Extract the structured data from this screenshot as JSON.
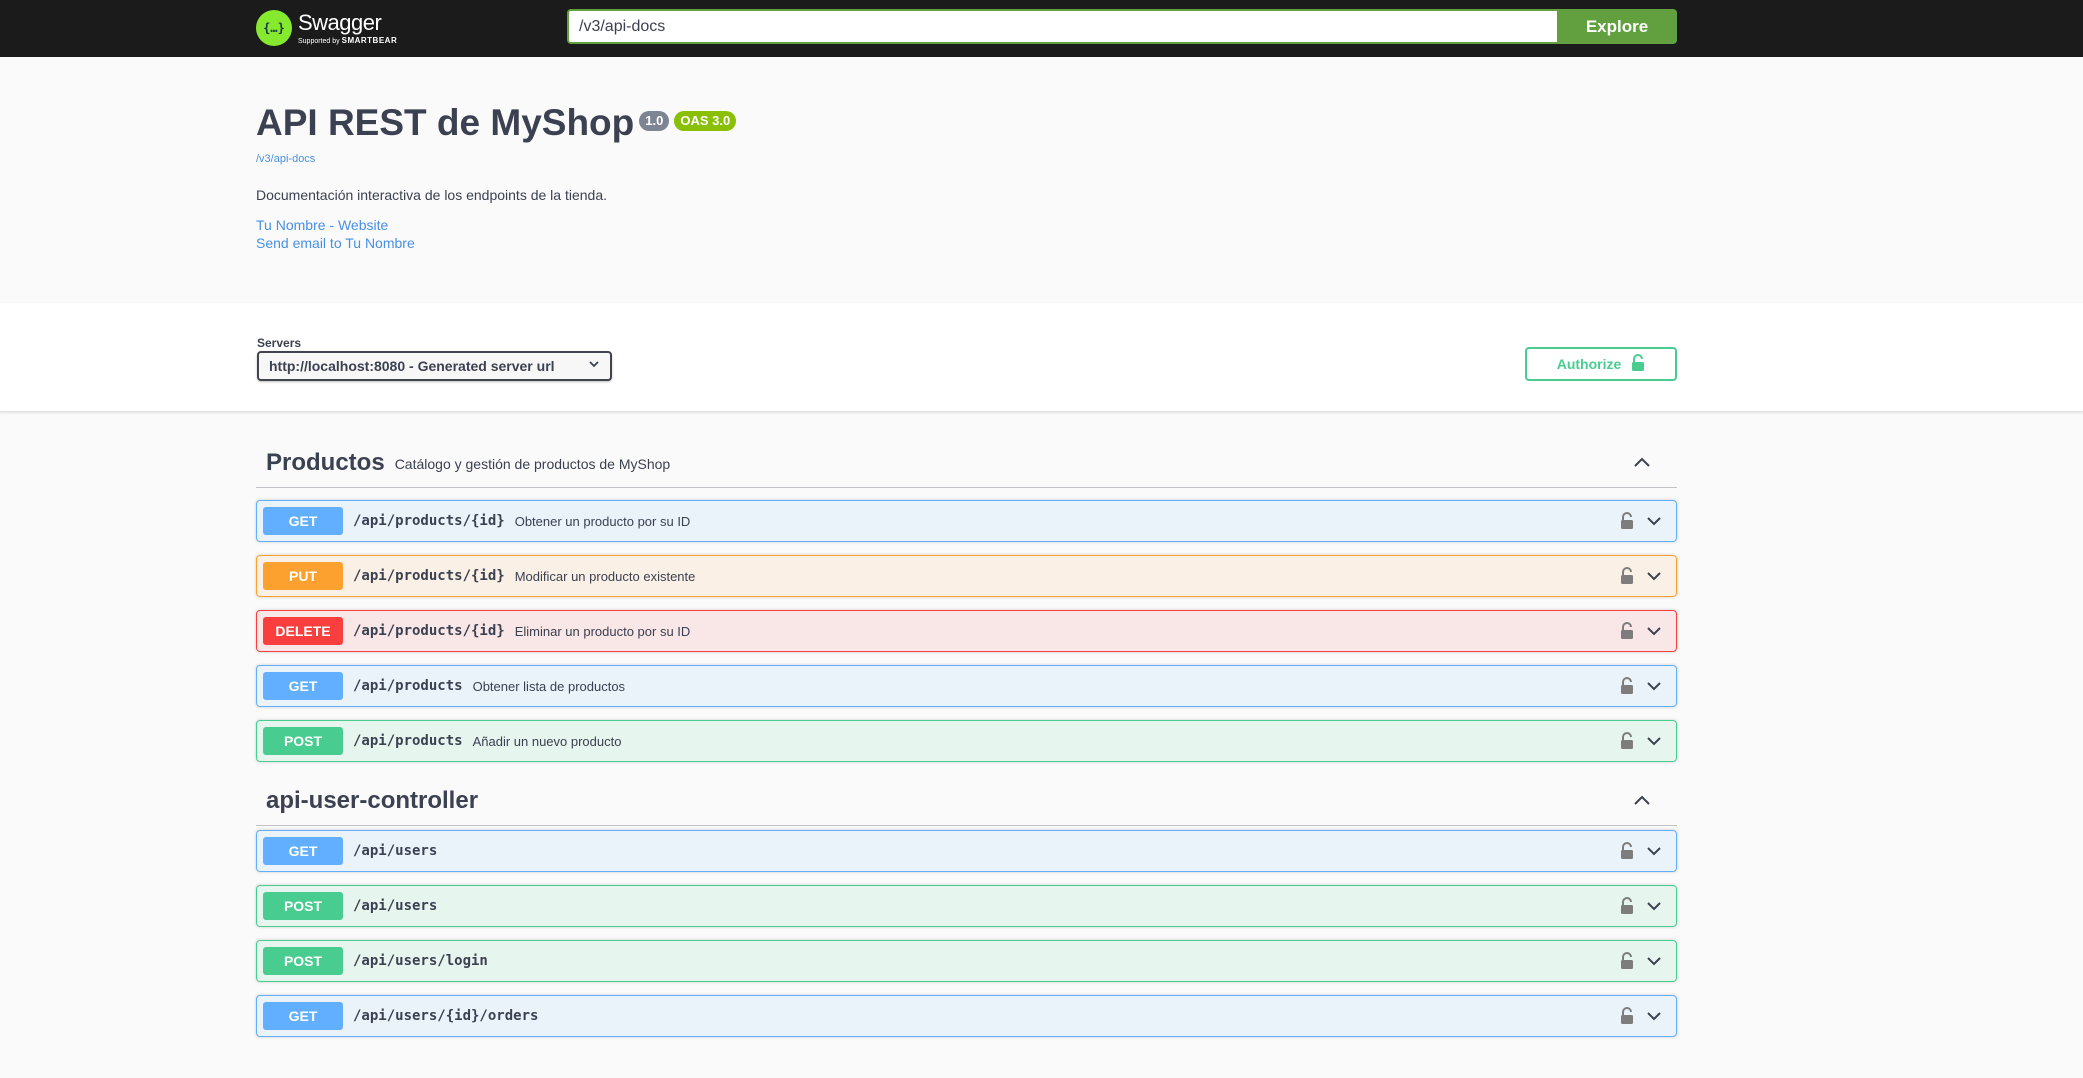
{
  "topbar": {
    "logo_word": "Swagger",
    "logo_sub_prefix": "Supported by",
    "logo_sub_brand": "SMARTBEAR",
    "explore_value": "/v3/api-docs",
    "explore_button": "Explore"
  },
  "info": {
    "title": "API REST de MyShop",
    "version": "1.0",
    "oas": "OAS 3.0",
    "spec_url": "/v3/api-docs",
    "description": "Documentación interactiva de los endpoints de la tienda.",
    "website_link": "Tu Nombre - Website",
    "email_link": "Send email to Tu Nombre"
  },
  "servers": {
    "label": "Servers",
    "selected": "http://localhost:8080 - Generated server url"
  },
  "authorize": {
    "label": "Authorize"
  },
  "tags": [
    {
      "name": "Productos",
      "description": "Catálogo y gestión de productos de MyShop",
      "operations": [
        {
          "method": "GET",
          "path": "/api/products/{id}",
          "summary": "Obtener un producto por su ID"
        },
        {
          "method": "PUT",
          "path": "/api/products/{id}",
          "summary": "Modificar un producto existente"
        },
        {
          "method": "DELETE",
          "path": "/api/products/{id}",
          "summary": "Eliminar un producto por su ID"
        },
        {
          "method": "GET",
          "path": "/api/products",
          "summary": "Obtener lista de productos"
        },
        {
          "method": "POST",
          "path": "/api/products",
          "summary": "Añadir un nuevo producto"
        }
      ]
    },
    {
      "name": "api-user-controller",
      "description": "",
      "operations": [
        {
          "method": "GET",
          "path": "/api/users",
          "summary": ""
        },
        {
          "method": "POST",
          "path": "/api/users",
          "summary": ""
        },
        {
          "method": "POST",
          "path": "/api/users/login",
          "summary": ""
        },
        {
          "method": "GET",
          "path": "/api/users/{id}/orders",
          "summary": ""
        }
      ]
    }
  ],
  "colors": {
    "get": "#61affe",
    "put": "#fca130",
    "delete": "#f93e3e",
    "post": "#49cc90",
    "topbar": "#1b1b1b",
    "explore": "#62a03f"
  },
  "icons": {
    "logo": "swagger-logo-icon",
    "lock": "lock-icon",
    "chevron_down": "chevron-down-icon",
    "chevron_up": "chevron-up-icon"
  }
}
